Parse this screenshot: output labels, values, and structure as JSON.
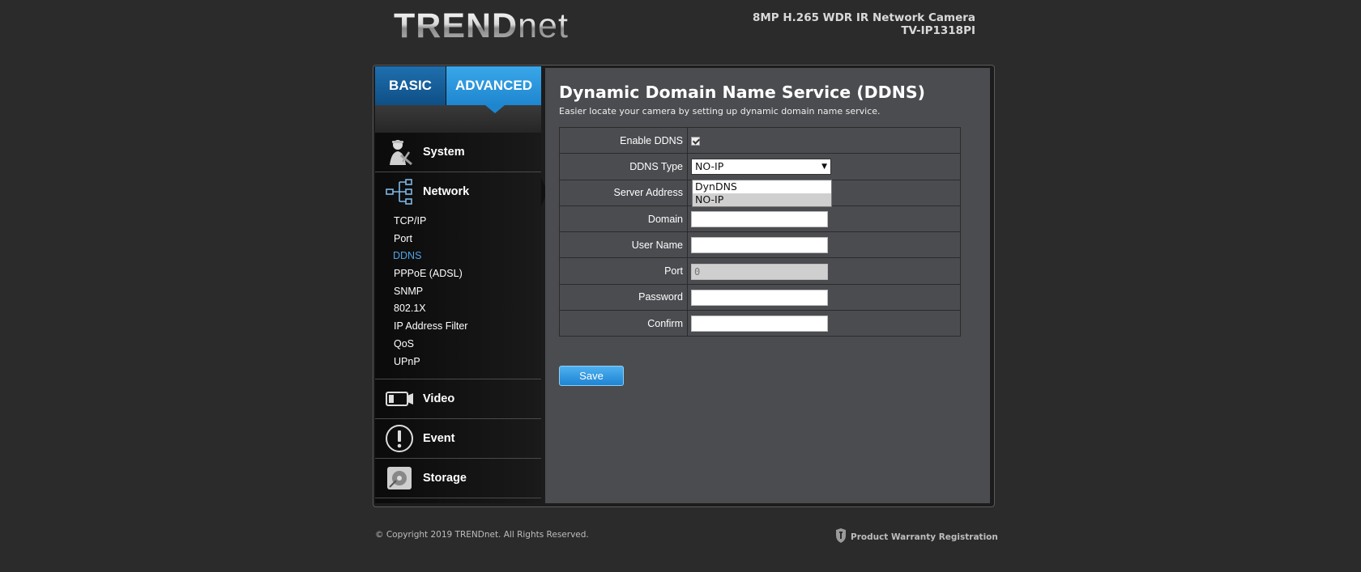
{
  "header": {
    "logo_main": "TREND",
    "logo_net": "net",
    "model_name": "8MP H.265 WDR IR Network Camera",
    "model_number": "TV-IP1318PI"
  },
  "tabs": {
    "basic": "BASIC",
    "advanced": "ADVANCED"
  },
  "menu": {
    "categories": {
      "system": "System",
      "network": "Network",
      "video": "Video",
      "event": "Event",
      "storage": "Storage"
    },
    "network_items": [
      "TCP/IP",
      "Port",
      "DDNS",
      "PPPoE (ADSL)",
      "SNMP",
      "802.1X",
      "IP Address Filter",
      "QoS",
      "UPnP"
    ],
    "active_item": "DDNS"
  },
  "page": {
    "title": "Dynamic Domain Name Service (DDNS)",
    "subtitle": "Easier locate your camera by setting up dynamic domain name service."
  },
  "form": {
    "enable_label": "Enable DDNS",
    "enable_checked": true,
    "type_label": "DDNS Type",
    "type_value": "NO-IP",
    "type_options": [
      "DynDNS",
      "NO-IP"
    ],
    "server_label": "Server Address",
    "domain_label": "Domain",
    "domain_value": "",
    "username_label": "User Name",
    "username_value": "",
    "port_label": "Port",
    "port_value": "0",
    "password_label": "Password",
    "password_value": "",
    "confirm_label": "Confirm",
    "confirm_value": ""
  },
  "save_label": "Save",
  "footer": {
    "copyright": "© Copyright 2019 TRENDnet. All Rights Reserved.",
    "warranty": "Product Warranty Registration"
  },
  "colors": {
    "accent_blue": "#1e86cf",
    "active_link": "#4fa3e6",
    "content_bg": "#4b4c50",
    "page_bg": "#2b2b2b"
  }
}
